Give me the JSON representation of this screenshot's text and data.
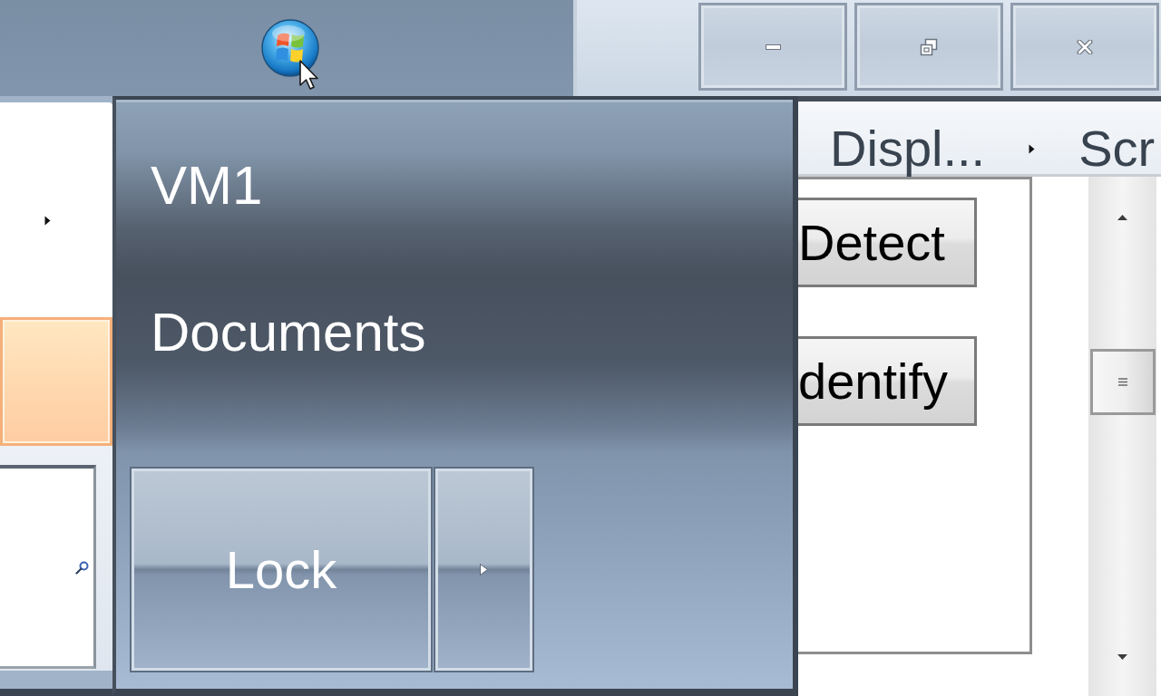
{
  "start_menu": {
    "programs": [
      {
        "submenu": true,
        "selected": false
      },
      {
        "submenu": false,
        "selected": true
      }
    ],
    "places": [
      {
        "label": "VM1"
      },
      {
        "label": "Documents"
      }
    ],
    "power_button": {
      "label": "Lock"
    }
  },
  "window": {
    "breadcrumb": [
      {
        "label": "Displ..."
      },
      {
        "label": "Scr"
      }
    ],
    "buttons": [
      {
        "label": "Detect"
      },
      {
        "label": "dentify"
      }
    ]
  }
}
